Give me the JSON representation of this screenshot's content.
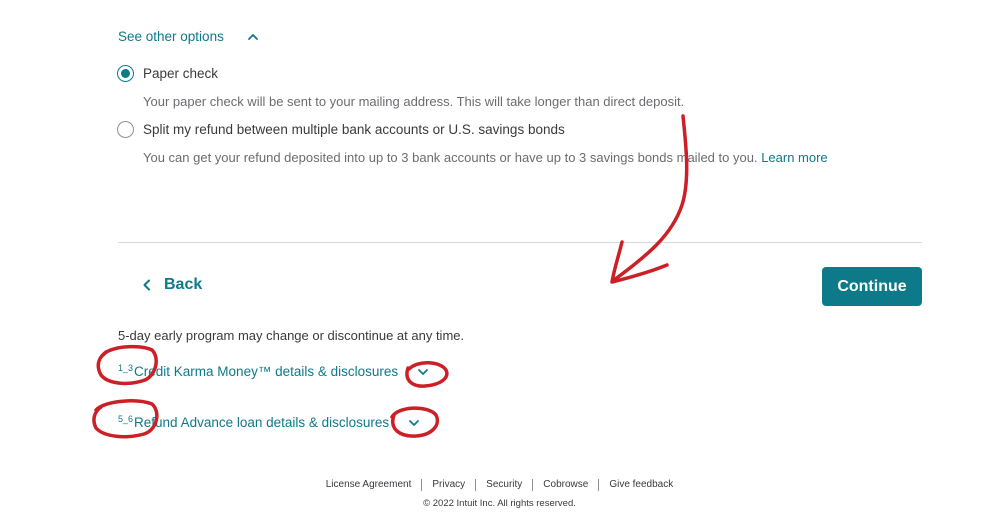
{
  "see_options": {
    "label": "See other options"
  },
  "options": [
    {
      "label": "Paper check",
      "description": "Your paper check will be sent to your mailing address. This will take longer than direct deposit.",
      "checked": true
    },
    {
      "label": "Split my refund between multiple bank accounts or U.S. savings bonds",
      "description": "You can get your refund deposited into up to 3 bank accounts or have up to 3 savings bonds mailed to you.",
      "link": "Learn more",
      "checked": false
    }
  ],
  "nav": {
    "back_label": "Back",
    "continue_label": "Continue"
  },
  "program_note": "5-day early program may change or discontinue at any time.",
  "disclosures": [
    {
      "sup": "1_3",
      "label": "Credit Karma Money™ details & disclosures"
    },
    {
      "sup": "5_6",
      "label": "Refund Advance loan details & disclosures"
    }
  ],
  "footer": {
    "links": [
      "License Agreement",
      "Privacy",
      "Security",
      "Cobrowse",
      "Give feedback"
    ],
    "copyright": "© 2022 Intuit Inc. All rights reserved."
  },
  "colors": {
    "accent": "#0d7a8a",
    "annotation": "#cc1f26"
  }
}
